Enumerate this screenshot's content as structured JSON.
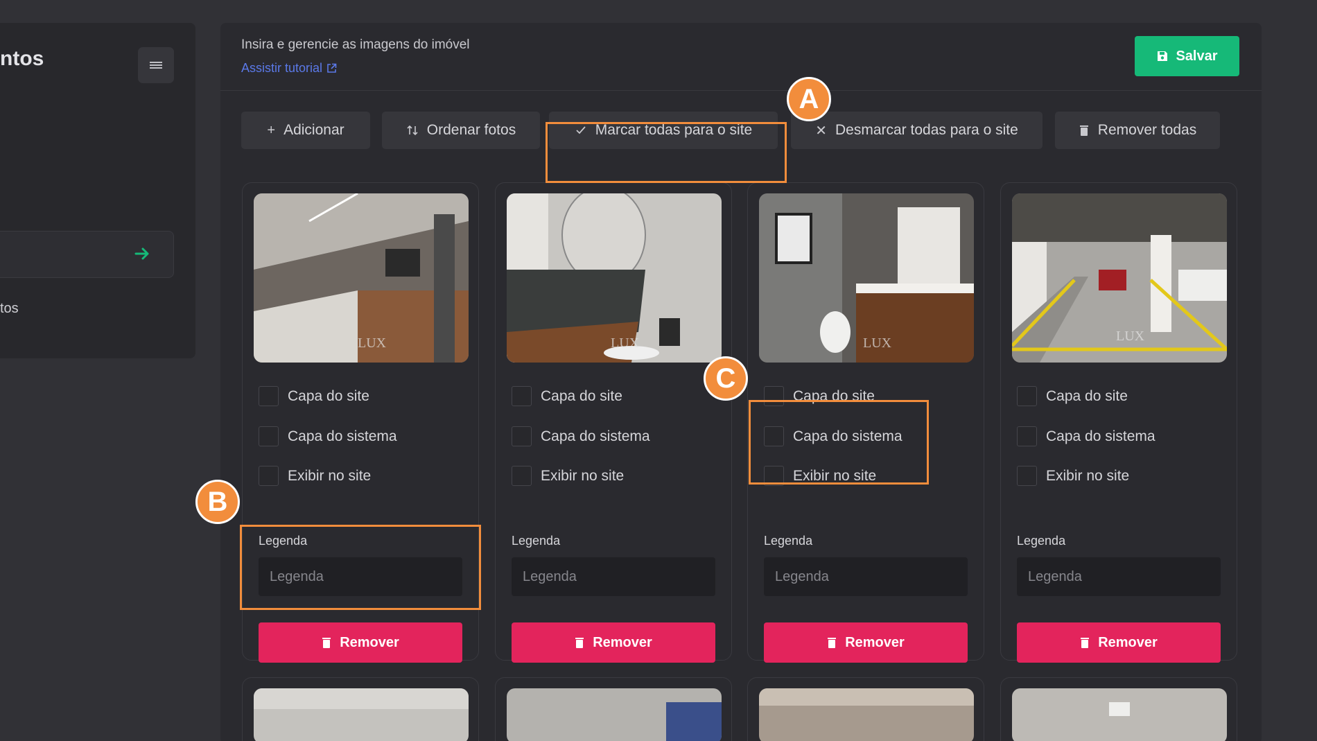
{
  "sidebar": {
    "title": "ntos",
    "item_text": "tos"
  },
  "header": {
    "description": "Insira e gerencie as imagens do imóvel",
    "tutorial_link": "Assistir tutorial",
    "save_label": "Salvar"
  },
  "toolbar": {
    "add": "Adicionar",
    "order": "Ordenar fotos",
    "mark_all": "Marcar todas para o site",
    "unmark_all": "Desmarcar todas para o site",
    "remove_all": "Remover todas"
  },
  "cards": [
    {
      "site_cover": "Capa do site",
      "system_cover": "Capa do sistema",
      "show_on_site": "Exibir no site",
      "caption_label": "Legenda",
      "caption_placeholder": "Legenda",
      "remove": "Remover",
      "watermark": "LUX"
    },
    {
      "site_cover": "Capa do site",
      "system_cover": "Capa do sistema",
      "show_on_site": "Exibir no site",
      "caption_label": "Legenda",
      "caption_placeholder": "Legenda",
      "remove": "Remover",
      "watermark": "LUX"
    },
    {
      "site_cover": "Capa do site",
      "system_cover": "Capa do sistema",
      "show_on_site": "Exibir no site",
      "caption_label": "Legenda",
      "caption_placeholder": "Legenda",
      "remove": "Remover",
      "watermark": "LUX"
    },
    {
      "site_cover": "Capa do site",
      "system_cover": "Capa do sistema",
      "show_on_site": "Exibir no site",
      "caption_label": "Legenda",
      "caption_placeholder": "Legenda",
      "remove": "Remover",
      "watermark": "LUX"
    }
  ],
  "annotations": {
    "a": "A",
    "b": "B",
    "c": "C"
  },
  "colors": {
    "accent_green": "#16b978",
    "danger": "#e3245c",
    "annotation": "#f28d3c",
    "link": "#5b79e8"
  }
}
